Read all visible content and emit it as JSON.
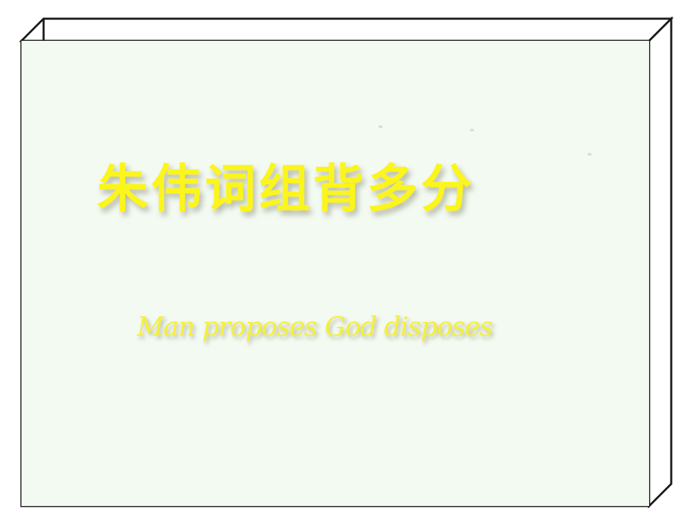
{
  "slide": {
    "title": "朱伟词组背多分",
    "subtitle": "Man proposes God disposes"
  },
  "colors": {
    "panel_background": "#f3faf2",
    "title_text": "#fbf51c",
    "subtitle_text": "#f5ef3a",
    "border": "#1a1a1a"
  }
}
